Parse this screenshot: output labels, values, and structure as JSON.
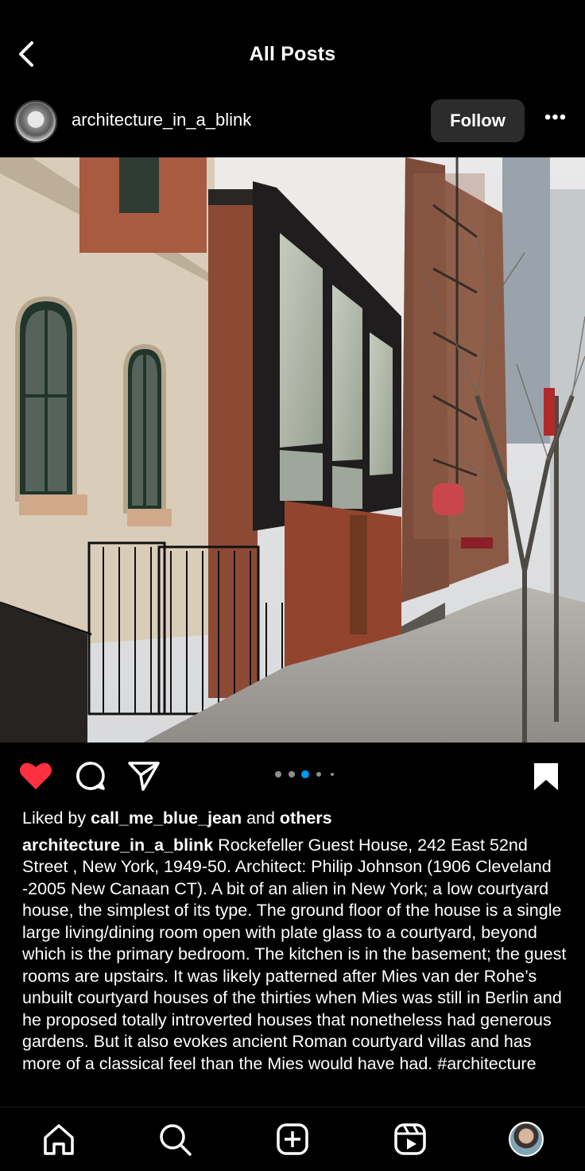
{
  "topbar": {
    "title": "All Posts",
    "back_icon": "chevron-left-icon"
  },
  "post": {
    "username": "architecture_in_a_blink",
    "follow_label": "Follow",
    "more_icon": "ellipsis-icon",
    "more_label": "•••",
    "carousel": {
      "count": 5,
      "active_index": 2
    },
    "liked_prefix": "Liked by ",
    "liked_user": "call_me_blue_jean",
    "liked_mid": " and ",
    "liked_suffix": "others",
    "caption_user": "architecture_in_a_blink",
    "caption_text": "Rockefeller Guest House, 242 East 52nd Street , New York, 1949-50. Architect: Philip Johnson (1906 Cleveland -2005 New Canaan CT). A bit of an alien in New York; a low courtyard house, the simplest of its type. The ground floor of the house is a single large living/dining room open with plate glass to a courtyard, beyond which is the primary bedroom. The kitchen is in the basement; the guest rooms are upstairs. It was likely patterned after Mies van der Rohe’s unbuilt courtyard houses of the thirties when Mies was still in Berlin and he proposed totally introverted houses that nonetheless had generous gardens. But it also evokes ancient Roman courtyard villas and has more of a classical feel than the Mies would have had. #architecture",
    "liked": true,
    "saved": true
  },
  "colors": {
    "like_red": "#ff3040",
    "carousel_active": "#0095f6",
    "follow_bg": "#2c2c2c"
  },
  "navbar": [
    "home-icon",
    "search-icon",
    "create-icon",
    "reels-icon",
    "profile-avatar"
  ]
}
